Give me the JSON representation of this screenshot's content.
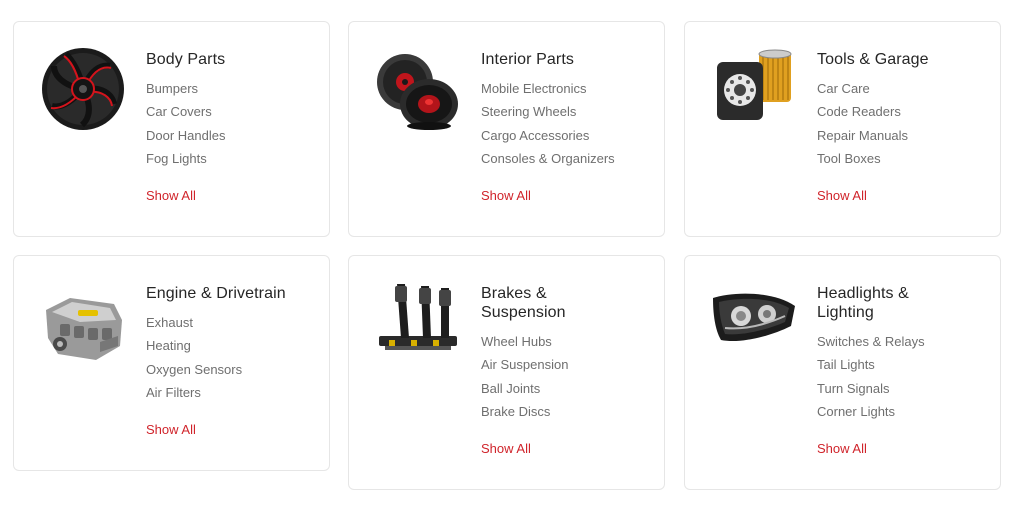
{
  "categories": [
    {
      "title": "Body Parts",
      "icon": "wheel-rim-icon",
      "items": [
        "Bumpers",
        "Car Covers",
        "Door Handles",
        "Fog Lights"
      ],
      "show_all": "Show All"
    },
    {
      "title": "Interior Parts",
      "icon": "speaker-icon",
      "items": [
        "Mobile Electronics",
        "Steering Wheels",
        "Cargo Accessories",
        "Consoles & Organizers"
      ],
      "show_all": "Show All"
    },
    {
      "title": "Tools & Garage",
      "icon": "oil-filter-icon",
      "items": [
        "Car Care",
        "Code Readers",
        "Repair Manuals",
        "Tool Boxes"
      ],
      "show_all": "Show All"
    },
    {
      "title": "Engine & Drivetrain",
      "icon": "engine-icon",
      "items": [
        "Exhaust",
        "Heating",
        "Oxygen Sensors",
        "Air Filters"
      ],
      "show_all": "Show All"
    },
    {
      "title": "Brakes & Suspension",
      "icon": "pedals-icon",
      "items": [
        "Wheel Hubs",
        "Air Suspension",
        "Ball Joints",
        "Brake Discs"
      ],
      "show_all": "Show All"
    },
    {
      "title": "Headlights & Lighting",
      "icon": "headlight-icon",
      "items": [
        "Switches & Relays",
        "Tail Lights",
        "Turn Signals",
        "Corner Lights"
      ],
      "show_all": "Show All"
    }
  ],
  "colors": {
    "accent": "#d0242b",
    "title": "#262626",
    "link": "#6f6f6f",
    "border": "#e6e6e6"
  }
}
